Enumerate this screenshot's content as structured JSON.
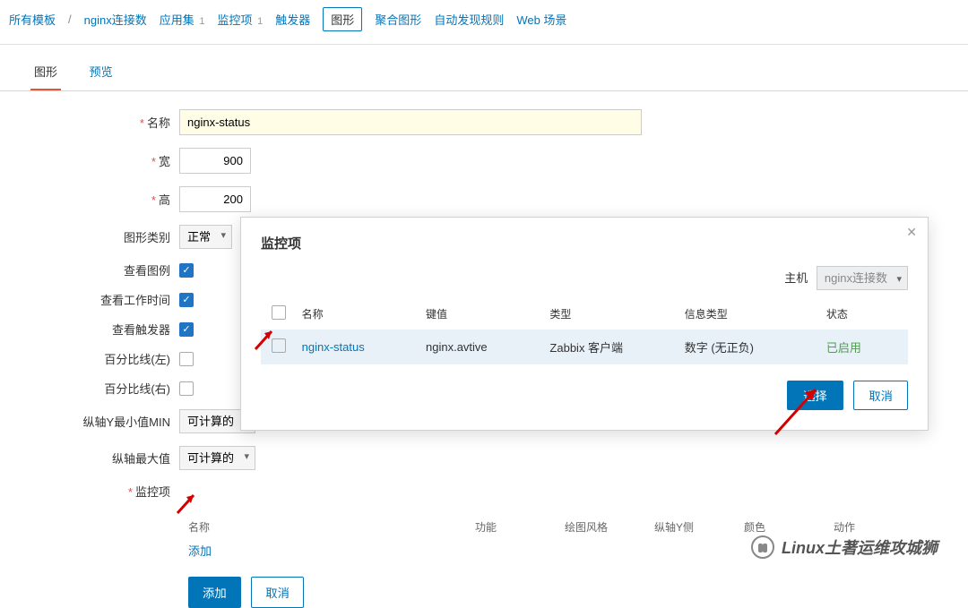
{
  "breadcrumb": {
    "all_templates": "所有模板",
    "template_name": "nginx连接数",
    "app_set": "应用集",
    "app_set_count": "1",
    "items": "监控项",
    "items_count": "1",
    "triggers": "触发器",
    "graphs": "图形",
    "screens": "聚合图形",
    "discovery": "自动发现规则",
    "web": "Web 场景"
  },
  "subtabs": {
    "graph": "图形",
    "preview": "预览"
  },
  "form": {
    "name_label": "名称",
    "name_value": "nginx-status",
    "width_label": "宽",
    "width_value": "900",
    "height_label": "高",
    "height_value": "200",
    "graph_type_label": "图形类别",
    "graph_type_value": "正常",
    "show_legend_label": "查看图例",
    "show_work_label": "查看工作时间",
    "show_trig_label": "查看触发器",
    "percentile_left_label": "百分比线(左)",
    "percentile_right_label": "百分比线(右)",
    "yaxis_min_label": "纵轴Y最小值MIN",
    "yaxis_min_value": "可计算的",
    "yaxis_max_label": "纵轴最大值",
    "yaxis_max_value": "可计算的",
    "items_label": "监控项",
    "items_cols": {
      "name": "名称",
      "func": "功能",
      "style": "绘图风格",
      "yaxis": "纵轴Y侧",
      "color": "颜色",
      "action": "动作"
    },
    "add_item": "添加",
    "submit": "添加",
    "cancel": "取消"
  },
  "modal": {
    "title": "监控项",
    "host_label": "主机",
    "host_value": "nginx连接数",
    "cols": {
      "name": "名称",
      "key": "键值",
      "type": "类型",
      "info": "信息类型",
      "status": "状态"
    },
    "row": {
      "name": "nginx-status",
      "key": "nginx.avtive",
      "type": "Zabbix 客户端",
      "info": "数字 (无正负)",
      "status": "已启用"
    },
    "select": "选择",
    "cancel": "取消"
  },
  "watermark": "Linux土著运维攻城狮"
}
